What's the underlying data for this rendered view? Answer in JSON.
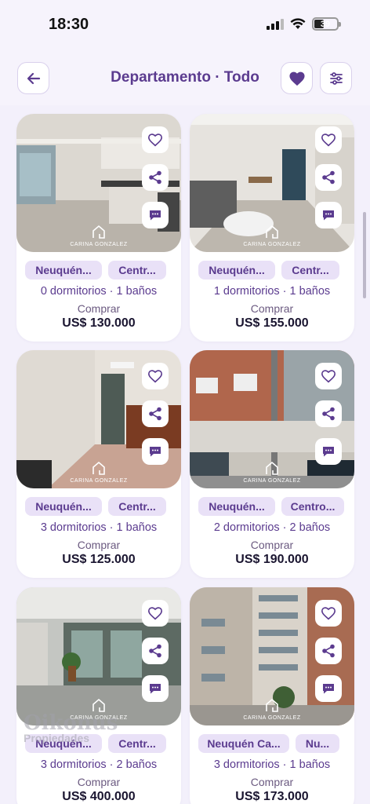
{
  "status": {
    "time": "18:30",
    "battery": "39"
  },
  "header": {
    "title": "Departamento · Todo"
  },
  "listings": [
    {
      "city": "Neuquén...",
      "zone": "Centr...",
      "details": "0 dormitorios · 1 baños",
      "operation": "Comprar",
      "price": "US$ 130.000",
      "watermark": "CARINA GONZALEZ"
    },
    {
      "city": "Neuquén...",
      "zone": "Centr...",
      "details": "1 dormitorios · 1 baños",
      "operation": "Comprar",
      "price": "US$ 155.000",
      "watermark": "CARINA GONZALEZ"
    },
    {
      "city": "Neuquén...",
      "zone": "Centr...",
      "details": "3 dormitorios · 1 baños",
      "operation": "Comprar",
      "price": "US$ 125.000",
      "watermark": "CARINA GONZALEZ"
    },
    {
      "city": "Neuquén...",
      "zone": "Centro...",
      "details": "2 dormitorios · 2 baños",
      "operation": "Comprar",
      "price": "US$ 190.000",
      "watermark": "CARINA GONZALEZ"
    },
    {
      "city": "Neuquén...",
      "zone": "Centr...",
      "details": "3 dormitorios · 2 baños",
      "operation": "Comprar",
      "price": "US$ 400.000",
      "watermark": "CARINA GONZALEZ"
    },
    {
      "city": "Neuquén Ca...",
      "zone": "Nu...",
      "details": "3 dormitorios · 1 baños",
      "operation": "Comprar",
      "price": "US$ 173.000",
      "watermark": "CARINA GONZALEZ"
    }
  ],
  "overlay_watermark": {
    "name": "Oikonus",
    "subtitle": "Propiedades"
  },
  "colors": {
    "accent": "#5b3b8f",
    "tag_bg": "#e9e1f7",
    "page_bg": "#f3f0fb"
  }
}
